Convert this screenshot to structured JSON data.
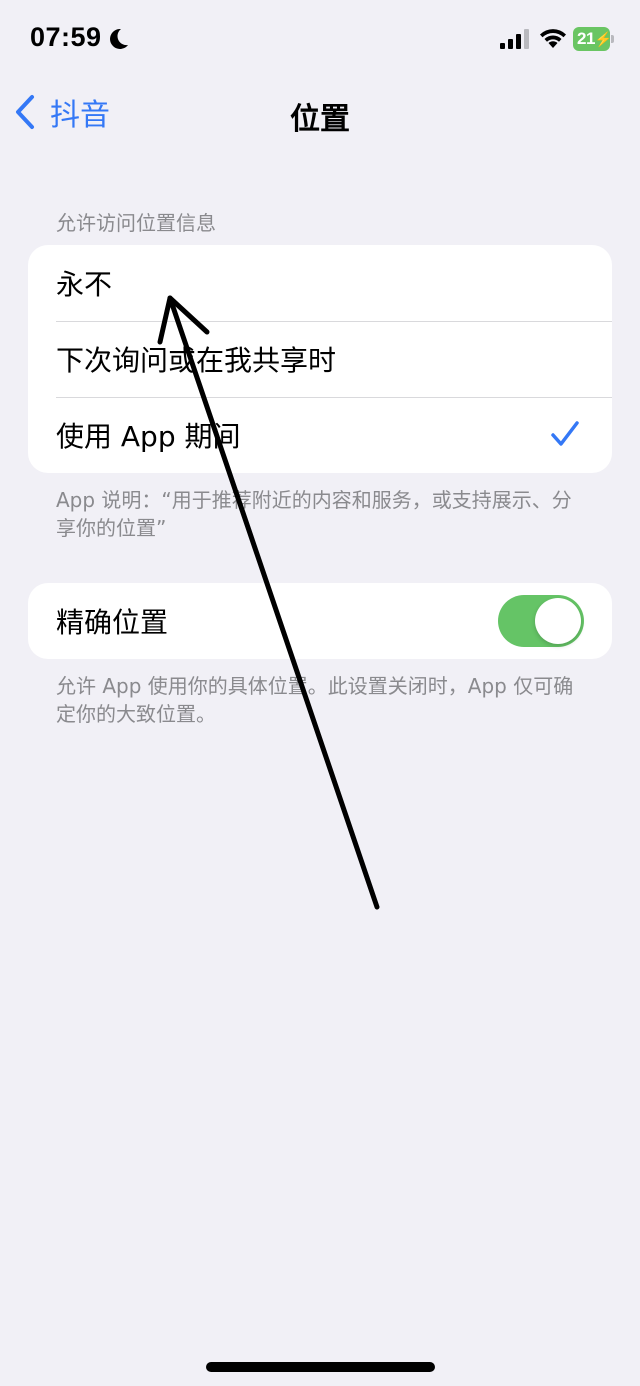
{
  "status_bar": {
    "time": "07:59",
    "battery_level": "21",
    "icons": [
      "moon-icon",
      "cellular-signal-icon",
      "wifi-icon",
      "battery-charging-icon"
    ]
  },
  "nav": {
    "back_label": "抖音",
    "title": "位置"
  },
  "location_access": {
    "header": "允许访问位置信息",
    "options": [
      {
        "label": "永不",
        "selected": false
      },
      {
        "label": "下次询问或在我共享时",
        "selected": false
      },
      {
        "label": "使用 App 期间",
        "selected": true
      }
    ],
    "footer": "App 说明：“用于推荐附近的内容和服务，或支持展示、分享你的位置”"
  },
  "precise_location": {
    "label": "精确位置",
    "enabled": true,
    "footer": "允许 App 使用你的具体位置。此设置关闭时，App 仅可确定你的大致位置。"
  },
  "colors": {
    "accent": "#3478f6",
    "toggle_on": "#65c466",
    "background": "#f1f0f6",
    "annotation": "#000000"
  }
}
